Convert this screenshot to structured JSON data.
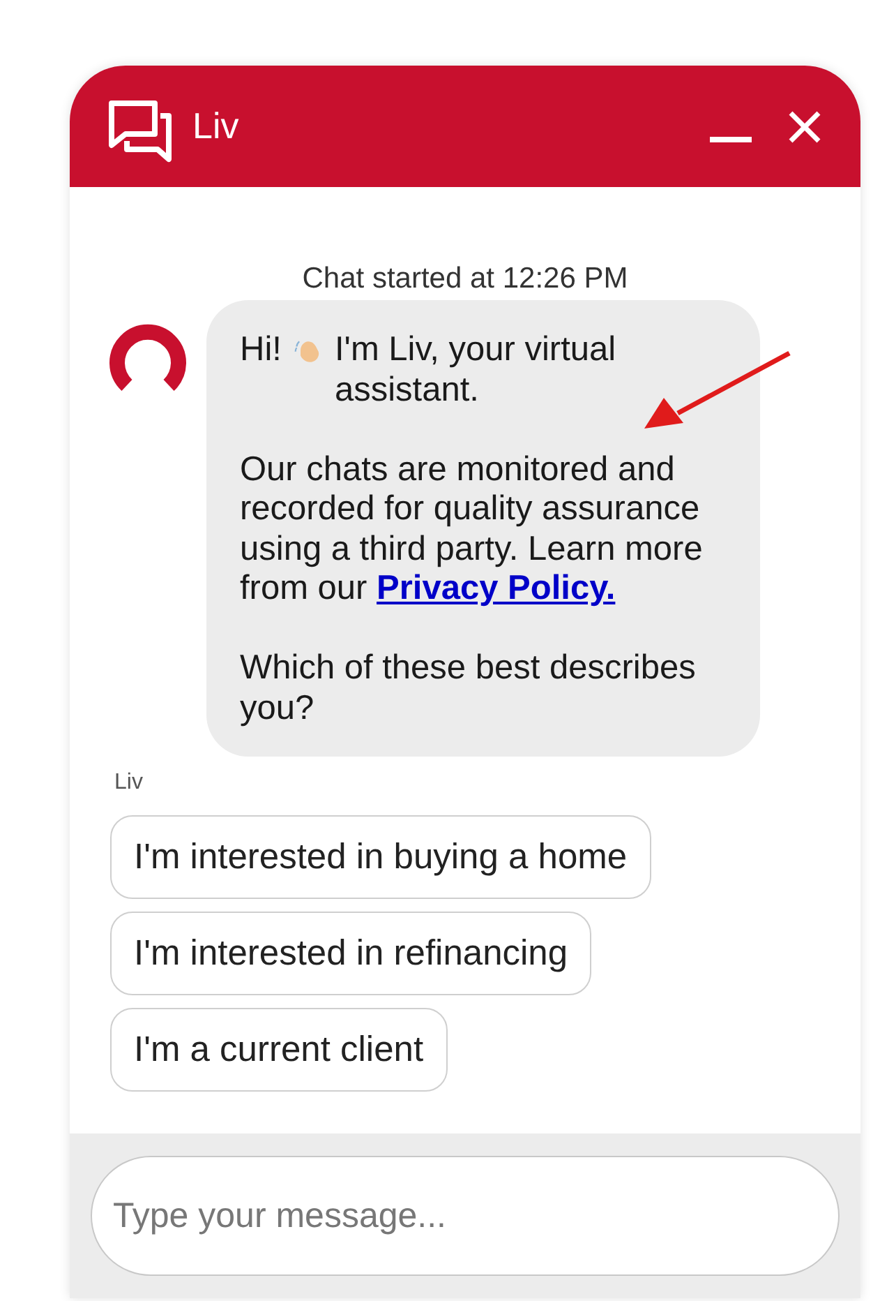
{
  "window": {
    "title": "Liv"
  },
  "chat": {
    "started": "Chat started at 12:26 PM",
    "message": {
      "greeting": "Hi!",
      "intro": "I'm Liv, your virtual assistant.",
      "notice": "Our chats are monitored and recorded for quality assurance using a third party. Learn more from our ",
      "link": "Privacy Policy. ",
      "question": "Which of these best describes you?"
    },
    "sender": "Liv",
    "options": [
      "I'm interested in buying a home",
      "I'm interested in refinancing",
      "I'm a current client"
    ]
  },
  "composer": {
    "placeholder": "Type your message..."
  }
}
